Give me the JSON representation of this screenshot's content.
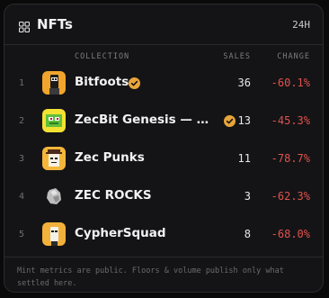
{
  "header": {
    "title": "NFTs",
    "range": "24H"
  },
  "columns": {
    "collection": "COLLECTION",
    "sales": "SALES",
    "change": "CHANGE"
  },
  "rows": [
    {
      "rank": "1",
      "name": "Bitfoots",
      "verified": true,
      "sales": "36",
      "change": "-60.1%",
      "avatar_icon": "bitfoots-avatar-icon"
    },
    {
      "rank": "2",
      "name": "ZecBit Genesis — Shiel…",
      "verified": true,
      "sales": "13",
      "change": "-45.3%",
      "avatar_icon": "zecbit-genesis-avatar-icon"
    },
    {
      "rank": "3",
      "name": "Zec Punks",
      "verified": false,
      "sales": "11",
      "change": "-78.7%",
      "avatar_icon": "zec-punks-avatar-icon"
    },
    {
      "rank": "4",
      "name": "ZEC ROCKS",
      "verified": false,
      "sales": "3",
      "change": "-62.3%",
      "avatar_icon": "zec-rocks-avatar-icon"
    },
    {
      "rank": "5",
      "name": "CypherSquad",
      "verified": false,
      "sales": "8",
      "change": "-68.0%",
      "avatar_icon": "cyphersquad-avatar-icon"
    }
  ],
  "footer": {
    "note": "Mint metrics are public. Floors & volume publish only what settled here."
  },
  "colors": {
    "negative": "#e0524d",
    "verified": "#e8a53a",
    "background": "#141416"
  }
}
